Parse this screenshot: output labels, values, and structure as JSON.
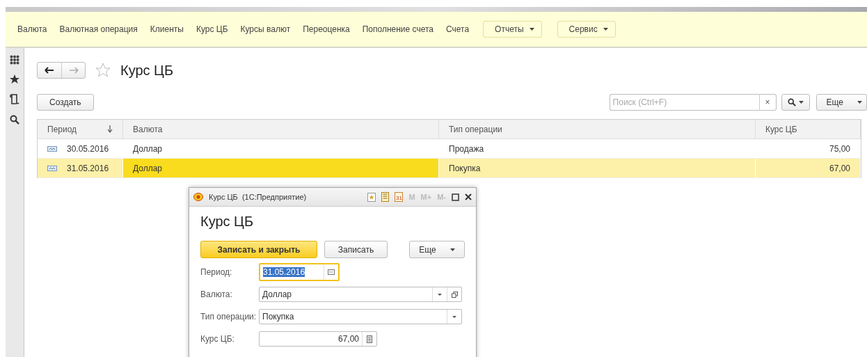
{
  "menu": [
    {
      "label": "Валюта",
      "kind": "link"
    },
    {
      "label": "Валютная операция",
      "kind": "link"
    },
    {
      "label": "Клиенты",
      "kind": "link"
    },
    {
      "label": "Курс ЦБ",
      "kind": "link"
    },
    {
      "label": "Курсы валют",
      "kind": "link"
    },
    {
      "label": "Переоценка",
      "kind": "link"
    },
    {
      "label": "Пополнение счета",
      "kind": "link"
    },
    {
      "label": "Счета",
      "kind": "link"
    },
    {
      "label": "Отчеты",
      "kind": "dropdown"
    },
    {
      "label": "Сервис",
      "kind": "dropdown"
    }
  ],
  "page": {
    "title": "Курс ЦБ",
    "favorite": false,
    "create_button": "Создать",
    "search": {
      "placeholder": "Поиск (Ctrl+F)",
      "clear": "×"
    },
    "more_button": "Еще"
  },
  "table": {
    "columns": [
      {
        "label": "Период",
        "sorted": true
      },
      {
        "label": "Валюта",
        "sorted": false
      },
      {
        "label": "Тип операции",
        "sorted": false
      },
      {
        "label": "Курс ЦБ",
        "sorted": false
      }
    ],
    "rows": [
      {
        "selected": false,
        "cells": [
          {
            "text": "30.05.2016",
            "current": false
          },
          {
            "text": "Доллар",
            "current": false
          },
          {
            "text": "Продажа",
            "current": false
          },
          {
            "text": "75,00",
            "current": false
          }
        ]
      },
      {
        "selected": true,
        "cells": [
          {
            "text": "31.05.2016",
            "current": false
          },
          {
            "text": "Доллар",
            "current": true
          },
          {
            "text": "Покупка",
            "current": false
          },
          {
            "text": "67,00",
            "current": false
          }
        ]
      }
    ]
  },
  "dialog": {
    "title": "Курс ЦБ  (1С:Предприятие)",
    "calendar_day": "31",
    "memory_buttons": [
      "M",
      "M+",
      "M-"
    ],
    "heading": "Курс ЦБ",
    "buttons": [
      {
        "label": "Записать и закрыть",
        "kind": "primary"
      },
      {
        "label": "Записать",
        "kind": "plain"
      },
      {
        "label": "Еще",
        "kind": "menu"
      }
    ],
    "fields": [
      {
        "label": "Период:",
        "value": "31.05.2016",
        "kind": "date",
        "focused": true
      },
      {
        "label": "Валюта:",
        "value": "Доллар",
        "kind": "reference",
        "focused": false
      },
      {
        "label": "Тип операции:",
        "value": "Покупка",
        "kind": "choice",
        "focused": false
      },
      {
        "label": "Курс ЦБ:",
        "value": "67,00",
        "kind": "number",
        "focused": false
      }
    ]
  }
}
